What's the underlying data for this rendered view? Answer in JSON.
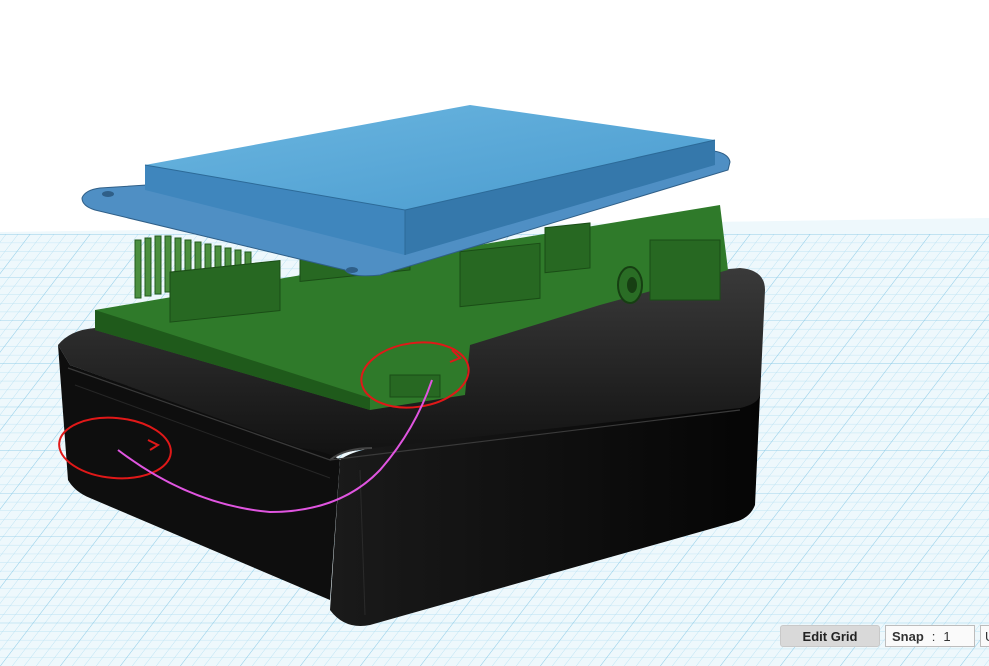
{
  "toolbar": {
    "edit_grid_label": "Edit Grid",
    "snap_label": "Snap",
    "snap_separator": ":",
    "snap_value": "1",
    "units_label": "U"
  },
  "colors": {
    "grid_background": "#e8f4fa",
    "grid_line": "#9fd4ec",
    "display_blue": "#5aa8d8",
    "pcb_green": "#2f7a2a",
    "case_black": "#111111",
    "annotation_red": "#e01818",
    "annotation_magenta": "#e055e0"
  },
  "scene": {
    "objects": [
      "display-module",
      "pcb-board",
      "enclosure-case"
    ],
    "annotations": [
      "red-circle-usb-port",
      "red-circle-case-side",
      "magenta-arrow"
    ]
  }
}
